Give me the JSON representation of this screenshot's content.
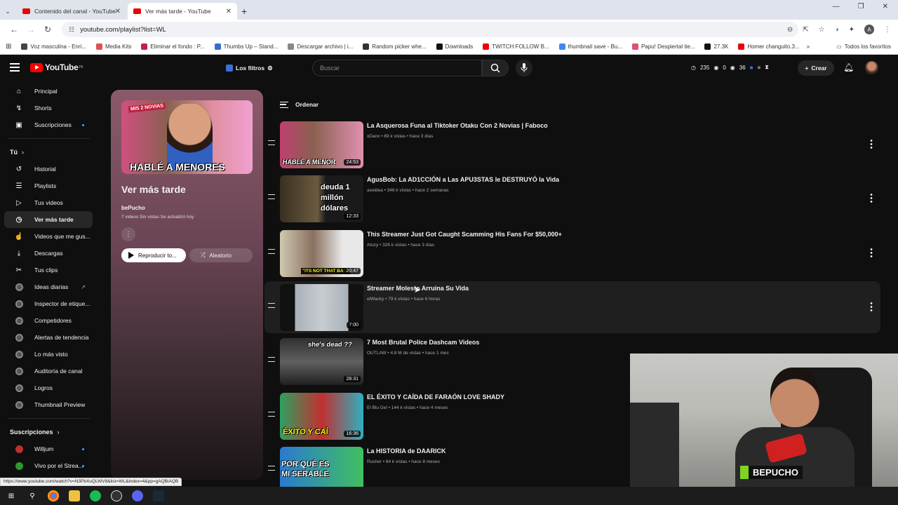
{
  "browser": {
    "tabs": [
      {
        "title": "Contenido del canal - YouTube",
        "active": false
      },
      {
        "title": "Ver más tarde - YouTube",
        "active": true
      }
    ],
    "new_tab": "+",
    "url": "youtube.com/playlist?list=WL",
    "bookmarks": [
      {
        "label": "Voz masculina - Enri...",
        "color": "#444"
      },
      {
        "label": "Media Kits",
        "color": "#e05050"
      },
      {
        "label": "Eliminar el fondo : P...",
        "color": "#c02050"
      },
      {
        "label": "Thumbs Up – Stand...",
        "color": "#3a6ad0"
      },
      {
        "label": "Descargar archivo | i...",
        "color": "#888"
      },
      {
        "label": "Random picker whe...",
        "color": "#333"
      },
      {
        "label": "Downloads",
        "color": "#111"
      },
      {
        "label": "TWITCH FOLLOW B...",
        "color": "#e00"
      },
      {
        "label": "thumbnail save - Bu...",
        "color": "#4285f4"
      },
      {
        "label": "Papu! Despiertal tie...",
        "color": "#e05070"
      },
      {
        "label": "27.3K",
        "color": "#111"
      },
      {
        "label": "Homer changuito.3...",
        "color": "#e00"
      }
    ],
    "bookmarks_more": "»",
    "all_favorites": "Todos los favoritos",
    "profile_letter": "A",
    "status_url": "https://www.youtube.com/watch?v=N3PbXuQLWV8&list=WL&index=4&pp=gAQBiAQB"
  },
  "youtube": {
    "logo": "YouTube",
    "logo_region": "PE",
    "filters_label": "Los filtros",
    "search_placeholder": "Buscar",
    "stats": [
      "235",
      "0",
      "36"
    ],
    "create_label": "Crear"
  },
  "sidebar": {
    "main": [
      {
        "label": "Principal",
        "icon": "home-icon",
        "glyph": "⌂"
      },
      {
        "label": "Shorts",
        "icon": "shorts-icon",
        "glyph": "↯"
      },
      {
        "label": "Suscripciones",
        "icon": "subscriptions-icon",
        "glyph": "▣",
        "dot": true
      }
    ],
    "you_heading": "Tú",
    "you": [
      {
        "label": "Historial",
        "icon": "history-icon",
        "glyph": "↺"
      },
      {
        "label": "Playlists",
        "icon": "playlists-icon",
        "glyph": "☰"
      },
      {
        "label": "Tus videos",
        "icon": "your-videos-icon",
        "glyph": "▷"
      },
      {
        "label": "Ver más tarde",
        "icon": "watch-later-icon",
        "glyph": "◷",
        "active": true
      },
      {
        "label": "Videos que me gus...",
        "icon": "like-icon",
        "glyph": "☝"
      },
      {
        "label": "Descargas",
        "icon": "download-icon",
        "glyph": "⤓"
      },
      {
        "label": "Tus clips",
        "icon": "scissors-icon",
        "glyph": "✂"
      }
    ],
    "tools": [
      {
        "label": "Ideas diarias",
        "ext": true
      },
      {
        "label": "Inspector de etique..."
      },
      {
        "label": "Competidores"
      },
      {
        "label": "Alertas de tendencia"
      },
      {
        "label": "Lo más visto"
      },
      {
        "label": "Auditoría de canal"
      },
      {
        "label": "Logros"
      },
      {
        "label": "Thumbnail Preview"
      }
    ],
    "subs_heading": "Suscripciones",
    "subs": [
      {
        "label": "Willjum",
        "color": "#c03030"
      },
      {
        "label": "Vivo por el Strea...",
        "color": "#2a9a2a"
      }
    ]
  },
  "playlist": {
    "thumb_badge": "MIS 2 NOVIAS",
    "thumb_title": "HABLÉ A MENORES",
    "title": "Ver más tarde",
    "owner": "bePucho",
    "meta": "7 videos   Sin vistas   Se actualizó hoy",
    "play_label": "Reproducir to...",
    "shuffle_label": "Aleatorio"
  },
  "sort_label": "Ordenar",
  "videos": [
    {
      "title": "La Asquerosa Funa al Tiktoker Otaku Con 2 Novias | Faboco",
      "meta": "xDanx • 89 k vistas • hace 3 días",
      "duration": "24:53",
      "thumb_text": "HABLÉ A MENOR",
      "bg": "linear-gradient(90deg,#c04070,#8a6050 40%,#e090b0)"
    },
    {
      "title": "AgusBob: La AD1CCIÓN a Las APU3STAS le DESTRUYÓ la Vida",
      "meta": "axeldea • 346 k vistas • hace 2 semanas",
      "duration": "12:33",
      "thumb_text": "deuda 1 millón dólares",
      "bg": "linear-gradient(90deg,#3a3020,#6a5a40 45%,#1a1a1a 55%)"
    },
    {
      "title": "This Streamer Just Got Caught Scamming His Fans For $50,000+",
      "meta": "Atozy • 326 k vistas • hace 3 días",
      "duration": "20:47",
      "thumb_text": "\"ITS NOT THAT BAD\"",
      "bg": "linear-gradient(90deg,#d0c8b0,#8a7060 40%,#e8e8e8 75%)"
    },
    {
      "title": "Streamer Molesto Arruina Su Vida",
      "meta": "elWacky • 79 k vistas • hace 6 horas",
      "duration": "7:00",
      "thumb_text": "",
      "bg": "linear-gradient(90deg,#111 18%,#a8b0b8 18%,#c8ccd0 50%,#a8b0b8 82%,#111 82%)",
      "hover": true
    },
    {
      "title": "7 Most Brutal Police Dashcam Videos",
      "meta": "OUTLAW • 4.8 M de vistas • hace 1 mes",
      "duration": "28:31",
      "thumb_text": "she's dead ??",
      "bg": "linear-gradient(180deg,#303030,#606060 50%,#202020)"
    },
    {
      "title": "EL ÉXITO Y CAÍDA DE FARAÓN LOVE SHADY",
      "meta": "El Blu Gel • 144 k vistas • hace 4 meses",
      "duration": "16:36",
      "thumb_text": "ÉXITO Y CAÍ",
      "bg": "linear-gradient(90deg,#30a060,#c03030 50%,#30b0c0)"
    },
    {
      "title": "La HISTORIA de DAARICK",
      "meta": "Rusher • 84 k vistas • hace 8 meses",
      "duration": "",
      "thumb_text": "POR QUÉ ES MI SERABLE",
      "bg": "linear-gradient(90deg,#2a7ad0,#40c060)"
    }
  ],
  "webcam_label": "BEPUCHO"
}
